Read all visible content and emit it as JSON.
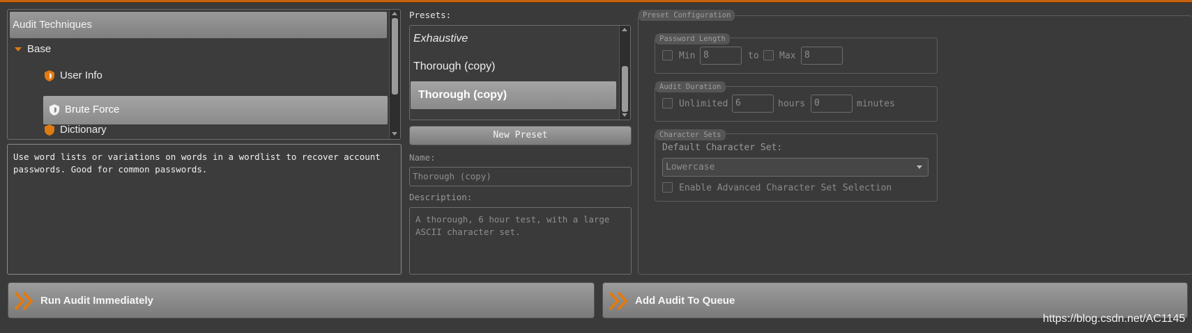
{
  "tree": {
    "header": "Audit Techniques",
    "items": [
      {
        "label": "Base",
        "icon": "triangle-down-icon"
      },
      {
        "label": "User Info",
        "icon": "shield-icon"
      },
      {
        "label": "Brute Force",
        "icon": "shield-icon",
        "selected": true
      },
      {
        "label": "Dictionary",
        "icon": "shield-icon"
      }
    ],
    "description": "Use word lists or variations on words in a wordlist to recover account passwords. Good for common passwords."
  },
  "presets": {
    "label": "Presets:",
    "items": [
      {
        "label": "Exhaustive",
        "italic": true
      },
      {
        "label": "Thorough (copy)"
      },
      {
        "label": "Thorough (copy)",
        "selected": true
      }
    ],
    "new_button": "New Preset",
    "name_label": "Name:",
    "name_value": "Thorough (copy)",
    "description_label": "Description:",
    "description_value": "A thorough, 6 hour test, with a large ASCII character set."
  },
  "config": {
    "title": "Preset Configuration",
    "password_length": {
      "title": "Password Length",
      "min_label": "Min",
      "min_value": "8",
      "to_label": "to",
      "max_label": "Max",
      "max_value": "8"
    },
    "audit_duration": {
      "title": "Audit Duration",
      "unlimited_label": "Unlimited",
      "hours_value": "6",
      "hours_label": "hours",
      "minutes_value": "0",
      "minutes_label": "minutes"
    },
    "character_sets": {
      "title": "Character Sets",
      "default_label": "Default Character Set:",
      "selected": "Lowercase",
      "advanced_label": "Enable Advanced Character Set Selection"
    }
  },
  "actions": {
    "run_label": "Run Audit Immediately",
    "queue_label": "Add Audit To Queue"
  },
  "watermark": "https://blog.csdn.net/AC1145",
  "colors": {
    "accent": "#e07a12",
    "background": "#3a3a3a"
  }
}
